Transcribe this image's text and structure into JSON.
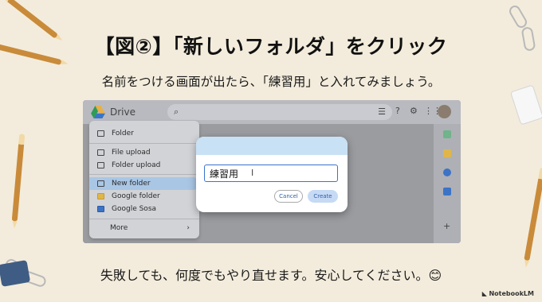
{
  "slide": {
    "headline": "【図②】「新しいフォルダ」をクリック",
    "subtitle": "名前をつける画面が出たら、「練習用」と入れてみましょう。",
    "footer": "失敗しても、何度でもやり直せます。安心してください。😊",
    "brand": "NotebookLM"
  },
  "drive": {
    "app_name": "Drive",
    "search_icon": "search-icon",
    "tune_icon": "tune-icon",
    "menu": {
      "items": [
        {
          "label": "Folder",
          "icon": "folder-icon"
        },
        {
          "label": "File upload",
          "icon": "file-upload-icon"
        },
        {
          "label": "Folder upload",
          "icon": "folder-upload-icon"
        },
        {
          "label": "New folder",
          "icon": "folder-icon",
          "active": true
        },
        {
          "label": "Google folder",
          "icon": "google-folder-icon"
        },
        {
          "label": "Google Sosa",
          "icon": "docs-icon"
        },
        {
          "label": "More",
          "icon": "chevron-right-icon"
        }
      ]
    },
    "dialog": {
      "input_value": "練習用",
      "cancel_label": "Cancel",
      "create_label": "Create"
    }
  },
  "colors": {
    "background": "#f3ecdc",
    "accent": "#3b73c9",
    "active_item": "#a9c6e5"
  }
}
